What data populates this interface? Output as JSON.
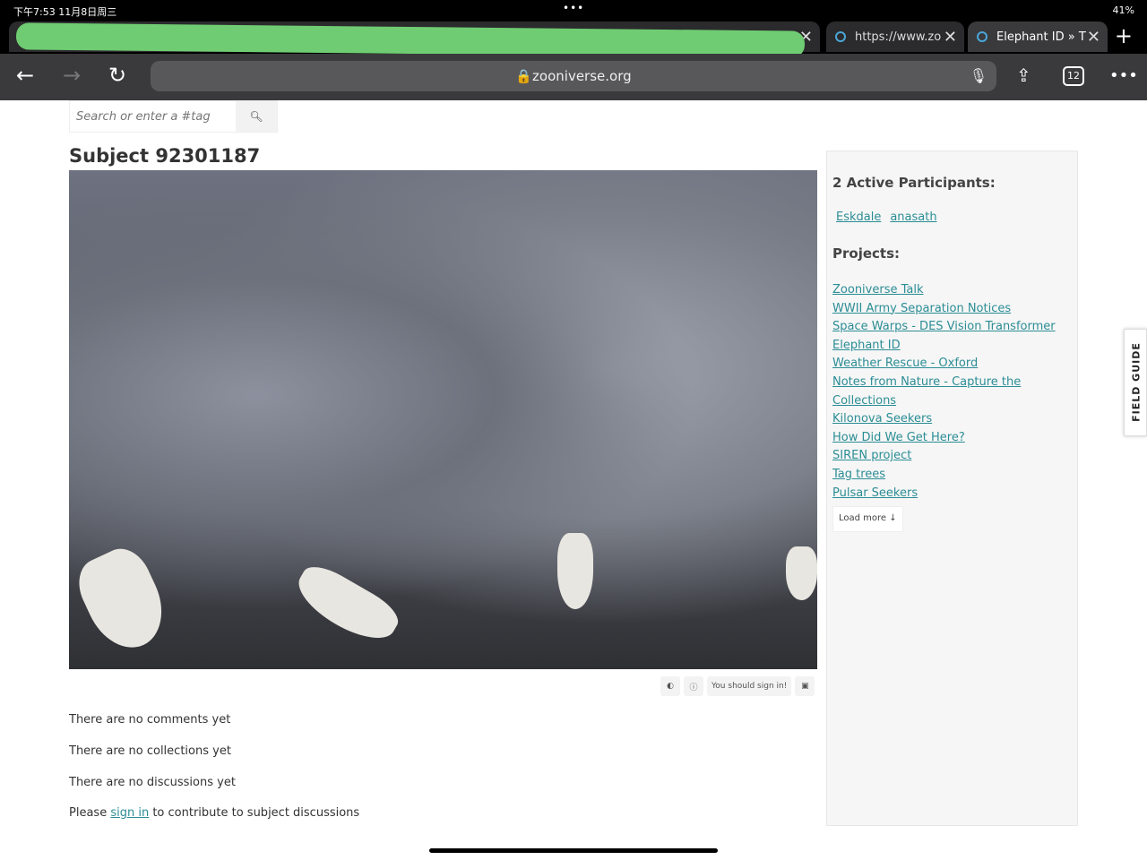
{
  "status": {
    "time": "下午7:53  11月8日周三",
    "battery": "41%"
  },
  "tabs": [
    {
      "label": "https://www.zo"
    },
    {
      "label": "Elephant ID » T"
    }
  ],
  "browser": {
    "url": "zooniverse.org",
    "tab_count": "12"
  },
  "search": {
    "placeholder": "Search or enter a #tag"
  },
  "subject": {
    "title": "Subject 92301187",
    "sign_in_notice": "You should sign in!"
  },
  "messages": {
    "comments": "There are no comments yet",
    "collections": "There are no collections yet",
    "discussions": "There are no discussions yet",
    "please": "Please ",
    "sign_in": "sign in",
    "contribute": " to contribute to subject discussions"
  },
  "sidebar": {
    "participants_heading": "2 Active Participants:",
    "participants": [
      "Eskdale",
      "anasath"
    ],
    "projects_heading": "Projects:",
    "projects": [
      "Zooniverse Talk",
      "WWII Army Separation Notices",
      "Space Warps - DES Vision Transformer",
      "Elephant ID",
      "Weather Rescue - Oxford",
      "Notes from Nature - Capture the Collections",
      "Kilonova Seekers",
      "How Did We Get Here?",
      "SIREN project",
      "Tag trees",
      "Pulsar Seekers"
    ],
    "load_more": "Load more ↓"
  },
  "field_guide": "FIELD GUIDE"
}
